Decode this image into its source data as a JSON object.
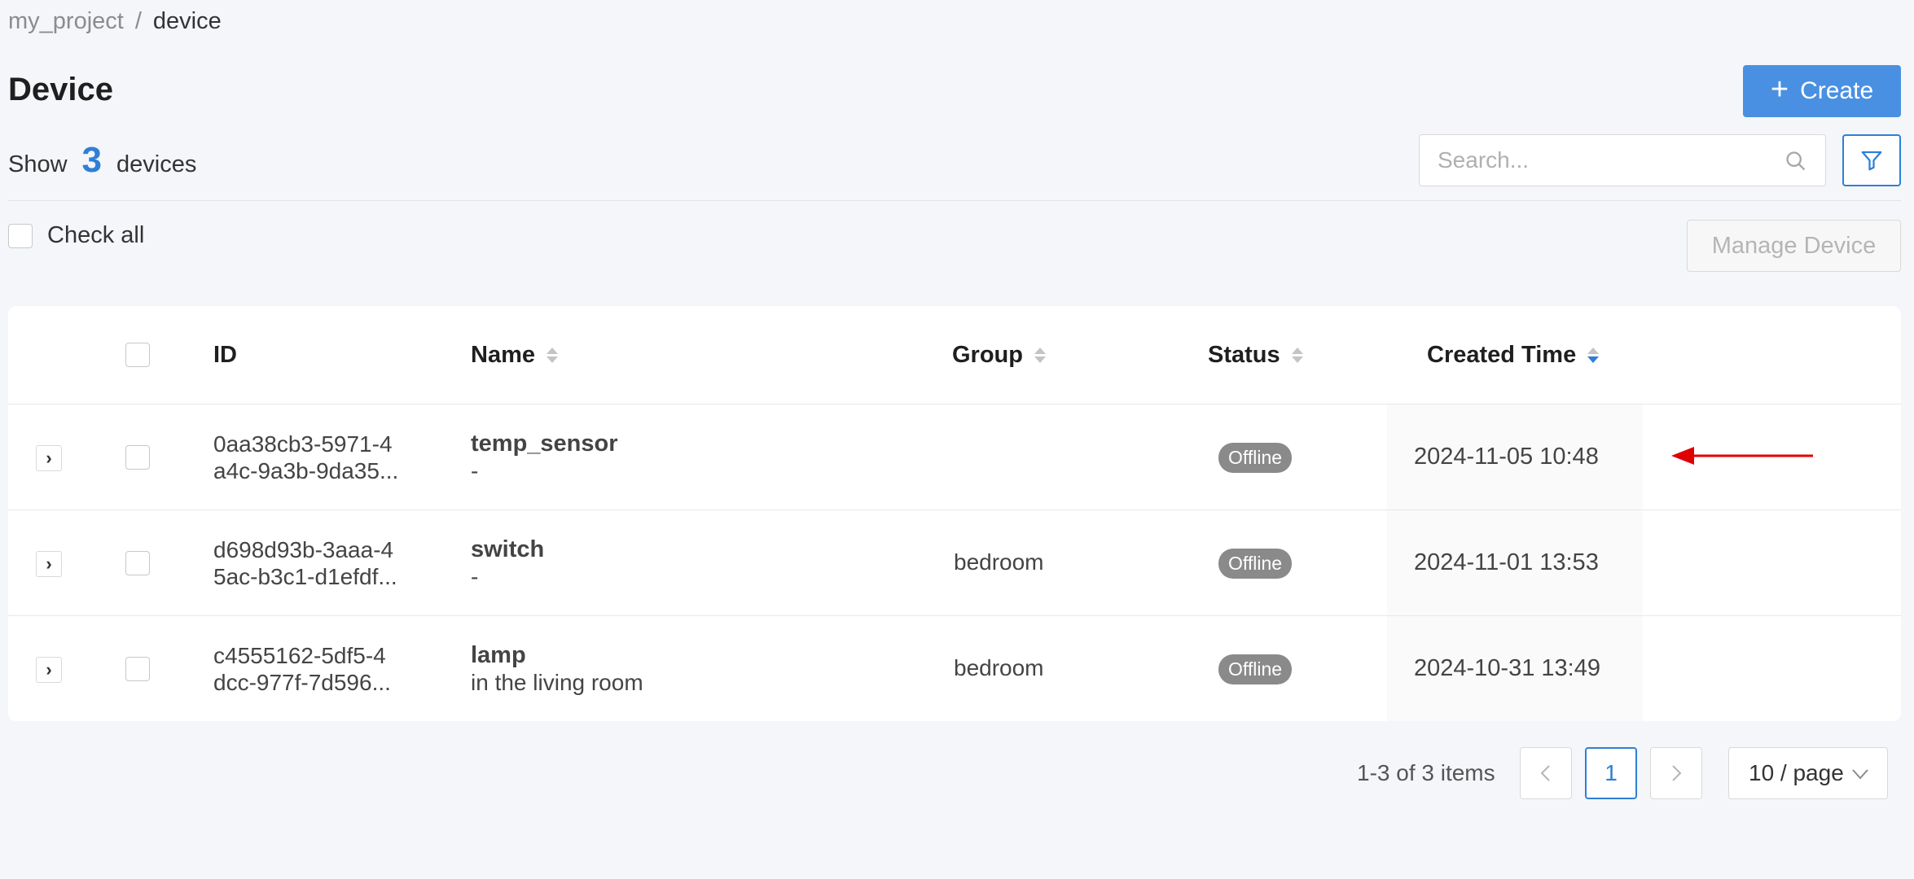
{
  "breadcrumb": {
    "project": "my_project",
    "separator": "/",
    "current": "device"
  },
  "page": {
    "title": "Device"
  },
  "create_button": {
    "icon": "plus-icon",
    "label": "Create"
  },
  "summary": {
    "prefix": "Show",
    "count": "3",
    "suffix": "devices"
  },
  "search": {
    "placeholder": "Search...",
    "value": ""
  },
  "filter_button": {
    "icon": "filter-icon"
  },
  "check_all": {
    "label": "Check all",
    "checked": false
  },
  "manage_button": {
    "label": "Manage Device",
    "disabled": true
  },
  "table": {
    "columns": {
      "id": "ID",
      "name": "Name",
      "group": "Group",
      "status": "Status",
      "created_time": "Created Time"
    },
    "sorted_by": "created_time",
    "sort_order": "descending",
    "rows": [
      {
        "id_line1": "0aa38cb3-5971-4",
        "id_line2": "a4c-9a3b-9da35...",
        "name": "temp_sensor",
        "description": "-",
        "group": "",
        "status": "Offline",
        "created_time": "2024-11-05 10:48"
      },
      {
        "id_line1": "d698d93b-3aaa-4",
        "id_line2": "5ac-b3c1-d1efdf...",
        "name": "switch",
        "description": "-",
        "group": "bedroom",
        "status": "Offline",
        "created_time": "2024-11-01 13:53"
      },
      {
        "id_line1": "c4555162-5df5-4",
        "id_line2": "dcc-977f-7d596...",
        "name": "lamp",
        "description": "in the living room",
        "group": "bedroom",
        "status": "Offline",
        "created_time": "2024-10-31 13:49"
      }
    ]
  },
  "annotation": {
    "icon": "red-arrow-icon",
    "color": "#e00000"
  },
  "pagination": {
    "total_text": "1-3 of 3 items",
    "current_page": "1",
    "page_size": "10 / page"
  },
  "colors": {
    "primary": "#4a90e2",
    "accent": "#2f7fd6",
    "badge_offline": "#8a8a8a",
    "background": "#f4f6fa"
  }
}
